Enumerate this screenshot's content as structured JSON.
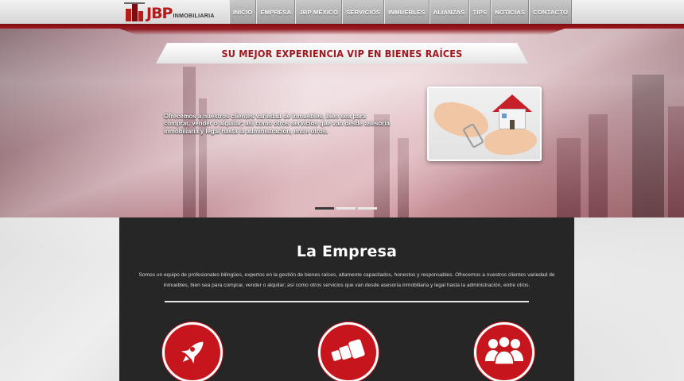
{
  "header": {
    "logo_text": "JBP",
    "logo_sub": "INMOBILIARIA",
    "nav": [
      "INICIO",
      "EMPRESA",
      "JBP MÉXICO",
      "SERVICIOS",
      "INMUEBLES",
      "ALIANZAS",
      "TIPS",
      "NOTICIAS",
      "CONTACTO"
    ]
  },
  "hero": {
    "banner": "SU MEJOR EXPERIENCIA VIP EN BIENES RAÍCES",
    "text": "Ofrecemos a nuestros clientes variedad de inmuebles, bien sea para comprar, vender o alquilar; así como otros servicios que van desde asesoría inmobiliaria y legal hasta la administración, entre otros.",
    "slide_count": 3,
    "active_slide": 1
  },
  "empresa": {
    "title": "La Empresa",
    "text": "Somos un equipo de profesionales bilingües, expertos en la gestión de bienes raíces, altamente capacitados, honestos y responsables. Ofrecemos a nuestros clientes variedad de inmuebles, bien sea para comprar, vender o alquilar; así como otros servicios que van desde asesoría inmobiliaria y legal hasta la administración, entre otros.",
    "icons": [
      "rocket-icon",
      "telescope-icon",
      "group-icon"
    ]
  },
  "colors": {
    "accent_red": "#c7151d",
    "dark_bg": "#262626"
  }
}
